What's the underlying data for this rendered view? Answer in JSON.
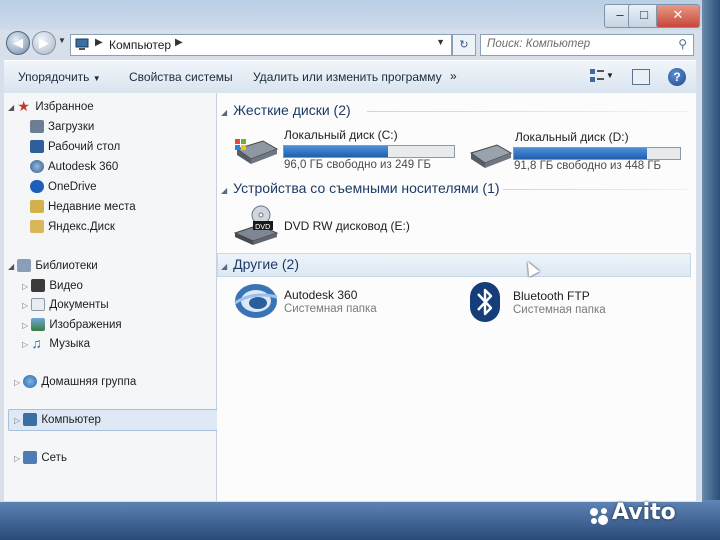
{
  "window": {
    "caption_buttons": {
      "minimize": "–",
      "maximize": "□",
      "close": "✕"
    }
  },
  "address_bar": {
    "back_glyph": "◀",
    "forward_glyph": "▶",
    "location": "Компьютер",
    "refresh_glyph": "↻"
  },
  "search": {
    "placeholder": "Поиск: Компьютер"
  },
  "toolbar": {
    "organize": "Упорядочить",
    "system_properties": "Свойства системы",
    "uninstall": "Удалить или изменить программу",
    "more": "»",
    "help": "?"
  },
  "navigation": {
    "favorites": {
      "label": "Избранное",
      "items": [
        "Загрузки",
        "Рабочий стол",
        "Autodesk 360",
        "OneDrive",
        "Недавние места",
        "Яндекс.Диск"
      ]
    },
    "libraries": {
      "label": "Библиотеки",
      "items": [
        "Видео",
        "Документы",
        "Изображения",
        "Музыка"
      ]
    },
    "homegroup": "Домашняя группа",
    "computer": "Компьютер",
    "network": "Сеть"
  },
  "groups": {
    "hard_drives": {
      "title": "Жесткие диски (2)",
      "drives": [
        {
          "name": "Локальный диск (C:)",
          "free": "96,0 ГБ свободно из 249 ГБ",
          "used_fraction": 0.61
        },
        {
          "name": "Локальный диск (D:)",
          "free": "91,8 ГБ свободно из 448 ГБ",
          "used_fraction": 0.8
        }
      ]
    },
    "removable": {
      "title": "Устройства со съемными носителями (1)",
      "items": [
        {
          "name": "DVD RW дисковод (E:)",
          "badge": "DVD"
        }
      ]
    },
    "other": {
      "title": "Другие (2)",
      "items": [
        {
          "name": "Autodesk 360",
          "sub": "Системная папка"
        },
        {
          "name": "Bluetooth FTP",
          "sub": "Системная папка"
        }
      ]
    }
  },
  "watermark": "Avito",
  "colors": {
    "accent": "#1f5fae",
    "group_header": "#1d3a67",
    "favorites_star": "#c0392b"
  }
}
